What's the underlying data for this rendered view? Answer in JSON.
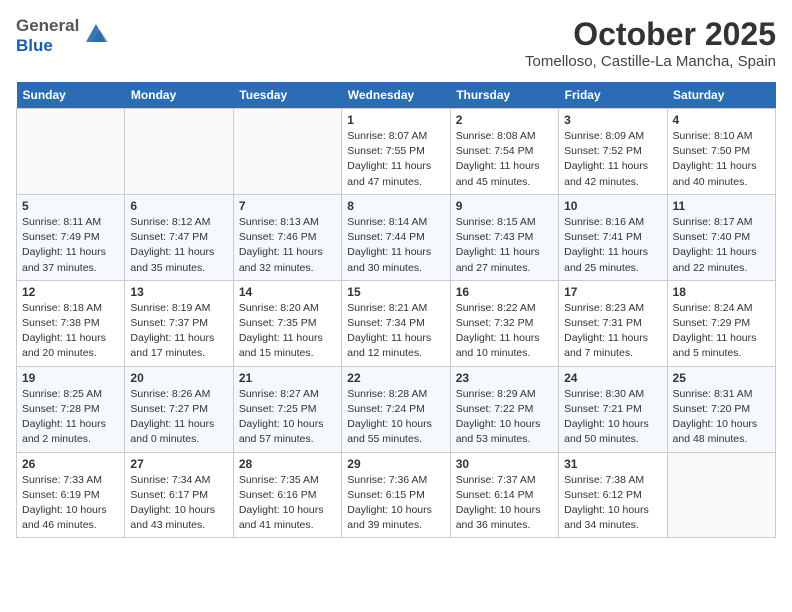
{
  "header": {
    "logo_line1": "General",
    "logo_line2": "Blue",
    "month_title": "October 2025",
    "location": "Tomelloso, Castille-La Mancha, Spain"
  },
  "weekdays": [
    "Sunday",
    "Monday",
    "Tuesday",
    "Wednesday",
    "Thursday",
    "Friday",
    "Saturday"
  ],
  "weeks": [
    [
      {
        "day": "",
        "empty": true
      },
      {
        "day": "",
        "empty": true
      },
      {
        "day": "",
        "empty": true
      },
      {
        "day": "1",
        "sunrise": "8:07 AM",
        "sunset": "7:55 PM",
        "daylight": "11 hours and 47 minutes."
      },
      {
        "day": "2",
        "sunrise": "8:08 AM",
        "sunset": "7:54 PM",
        "daylight": "11 hours and 45 minutes."
      },
      {
        "day": "3",
        "sunrise": "8:09 AM",
        "sunset": "7:52 PM",
        "daylight": "11 hours and 42 minutes."
      },
      {
        "day": "4",
        "sunrise": "8:10 AM",
        "sunset": "7:50 PM",
        "daylight": "11 hours and 40 minutes."
      }
    ],
    [
      {
        "day": "5",
        "sunrise": "8:11 AM",
        "sunset": "7:49 PM",
        "daylight": "11 hours and 37 minutes."
      },
      {
        "day": "6",
        "sunrise": "8:12 AM",
        "sunset": "7:47 PM",
        "daylight": "11 hours and 35 minutes."
      },
      {
        "day": "7",
        "sunrise": "8:13 AM",
        "sunset": "7:46 PM",
        "daylight": "11 hours and 32 minutes."
      },
      {
        "day": "8",
        "sunrise": "8:14 AM",
        "sunset": "7:44 PM",
        "daylight": "11 hours and 30 minutes."
      },
      {
        "day": "9",
        "sunrise": "8:15 AM",
        "sunset": "7:43 PM",
        "daylight": "11 hours and 27 minutes."
      },
      {
        "day": "10",
        "sunrise": "8:16 AM",
        "sunset": "7:41 PM",
        "daylight": "11 hours and 25 minutes."
      },
      {
        "day": "11",
        "sunrise": "8:17 AM",
        "sunset": "7:40 PM",
        "daylight": "11 hours and 22 minutes."
      }
    ],
    [
      {
        "day": "12",
        "sunrise": "8:18 AM",
        "sunset": "7:38 PM",
        "daylight": "11 hours and 20 minutes."
      },
      {
        "day": "13",
        "sunrise": "8:19 AM",
        "sunset": "7:37 PM",
        "daylight": "11 hours and 17 minutes."
      },
      {
        "day": "14",
        "sunrise": "8:20 AM",
        "sunset": "7:35 PM",
        "daylight": "11 hours and 15 minutes."
      },
      {
        "day": "15",
        "sunrise": "8:21 AM",
        "sunset": "7:34 PM",
        "daylight": "11 hours and 12 minutes."
      },
      {
        "day": "16",
        "sunrise": "8:22 AM",
        "sunset": "7:32 PM",
        "daylight": "11 hours and 10 minutes."
      },
      {
        "day": "17",
        "sunrise": "8:23 AM",
        "sunset": "7:31 PM",
        "daylight": "11 hours and 7 minutes."
      },
      {
        "day": "18",
        "sunrise": "8:24 AM",
        "sunset": "7:29 PM",
        "daylight": "11 hours and 5 minutes."
      }
    ],
    [
      {
        "day": "19",
        "sunrise": "8:25 AM",
        "sunset": "7:28 PM",
        "daylight": "11 hours and 2 minutes."
      },
      {
        "day": "20",
        "sunrise": "8:26 AM",
        "sunset": "7:27 PM",
        "daylight": "11 hours and 0 minutes."
      },
      {
        "day": "21",
        "sunrise": "8:27 AM",
        "sunset": "7:25 PM",
        "daylight": "10 hours and 57 minutes."
      },
      {
        "day": "22",
        "sunrise": "8:28 AM",
        "sunset": "7:24 PM",
        "daylight": "10 hours and 55 minutes."
      },
      {
        "day": "23",
        "sunrise": "8:29 AM",
        "sunset": "7:22 PM",
        "daylight": "10 hours and 53 minutes."
      },
      {
        "day": "24",
        "sunrise": "8:30 AM",
        "sunset": "7:21 PM",
        "daylight": "10 hours and 50 minutes."
      },
      {
        "day": "25",
        "sunrise": "8:31 AM",
        "sunset": "7:20 PM",
        "daylight": "10 hours and 48 minutes."
      }
    ],
    [
      {
        "day": "26",
        "sunrise": "7:33 AM",
        "sunset": "6:19 PM",
        "daylight": "10 hours and 46 minutes."
      },
      {
        "day": "27",
        "sunrise": "7:34 AM",
        "sunset": "6:17 PM",
        "daylight": "10 hours and 43 minutes."
      },
      {
        "day": "28",
        "sunrise": "7:35 AM",
        "sunset": "6:16 PM",
        "daylight": "10 hours and 41 minutes."
      },
      {
        "day": "29",
        "sunrise": "7:36 AM",
        "sunset": "6:15 PM",
        "daylight": "10 hours and 39 minutes."
      },
      {
        "day": "30",
        "sunrise": "7:37 AM",
        "sunset": "6:14 PM",
        "daylight": "10 hours and 36 minutes."
      },
      {
        "day": "31",
        "sunrise": "7:38 AM",
        "sunset": "6:12 PM",
        "daylight": "10 hours and 34 minutes."
      },
      {
        "day": "",
        "empty": true
      }
    ]
  ]
}
